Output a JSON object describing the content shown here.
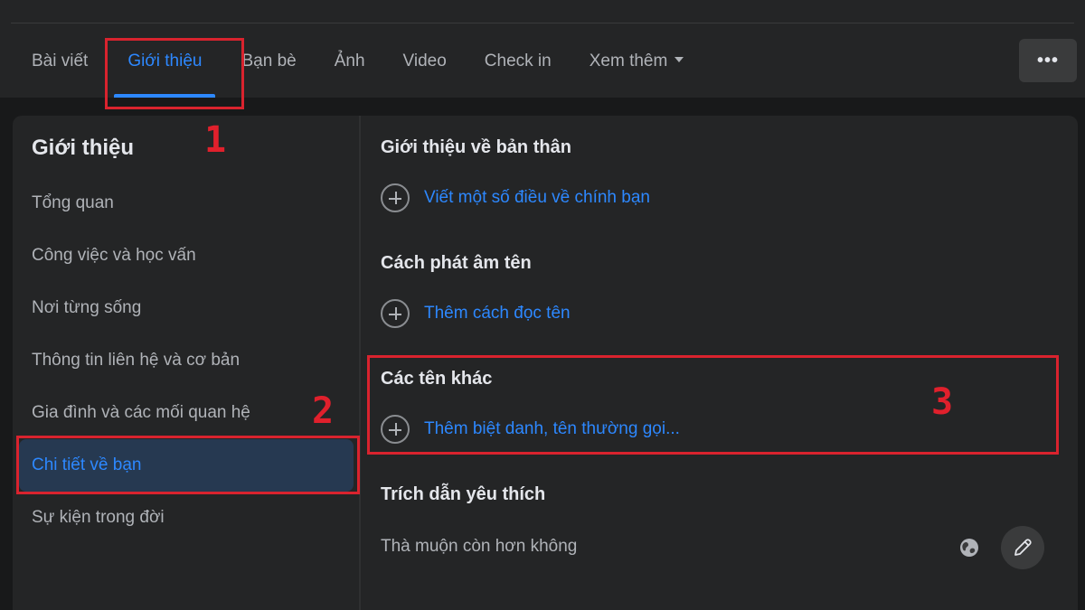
{
  "tabs": [
    {
      "label": "Bài viết"
    },
    {
      "label": "Giới thiệu",
      "active": true
    },
    {
      "label": "Bạn bè"
    },
    {
      "label": "Ảnh"
    },
    {
      "label": "Video"
    },
    {
      "label": "Check in"
    },
    {
      "label": "Xem thêm",
      "dropdown": true
    }
  ],
  "more_button": {
    "label": "•••",
    "icon": "more-horizontal-icon"
  },
  "sidebar": {
    "title": "Giới thiệu",
    "items": [
      {
        "label": "Tổng quan"
      },
      {
        "label": "Công việc và học vấn"
      },
      {
        "label": "Nơi từng sống"
      },
      {
        "label": "Thông tin liên hệ và cơ bản"
      },
      {
        "label": "Gia đình và các mối quan hệ"
      },
      {
        "label": "Chi tiết về bạn",
        "active": true
      },
      {
        "label": "Sự kiện trong đời"
      }
    ]
  },
  "main": {
    "sections": [
      {
        "title": "Giới thiệu về bản thân",
        "action": "Viết một số điều về chính bạn"
      },
      {
        "title": "Cách phát âm tên",
        "action": "Thêm cách đọc tên"
      },
      {
        "title": "Các tên khác",
        "action": "Thêm biệt danh, tên thường gọi..."
      },
      {
        "title": "Trích dẫn yêu thích",
        "value": "Thà muộn còn hơn không",
        "privacy_icon": "globe-icon",
        "edit_icon": "pencil-icon"
      }
    ]
  },
  "annotations": [
    "1",
    "2",
    "3"
  ],
  "colors": {
    "accent": "#2d88ff",
    "annotation": "#d9232e",
    "background": "#18191a",
    "surface": "#242526"
  }
}
